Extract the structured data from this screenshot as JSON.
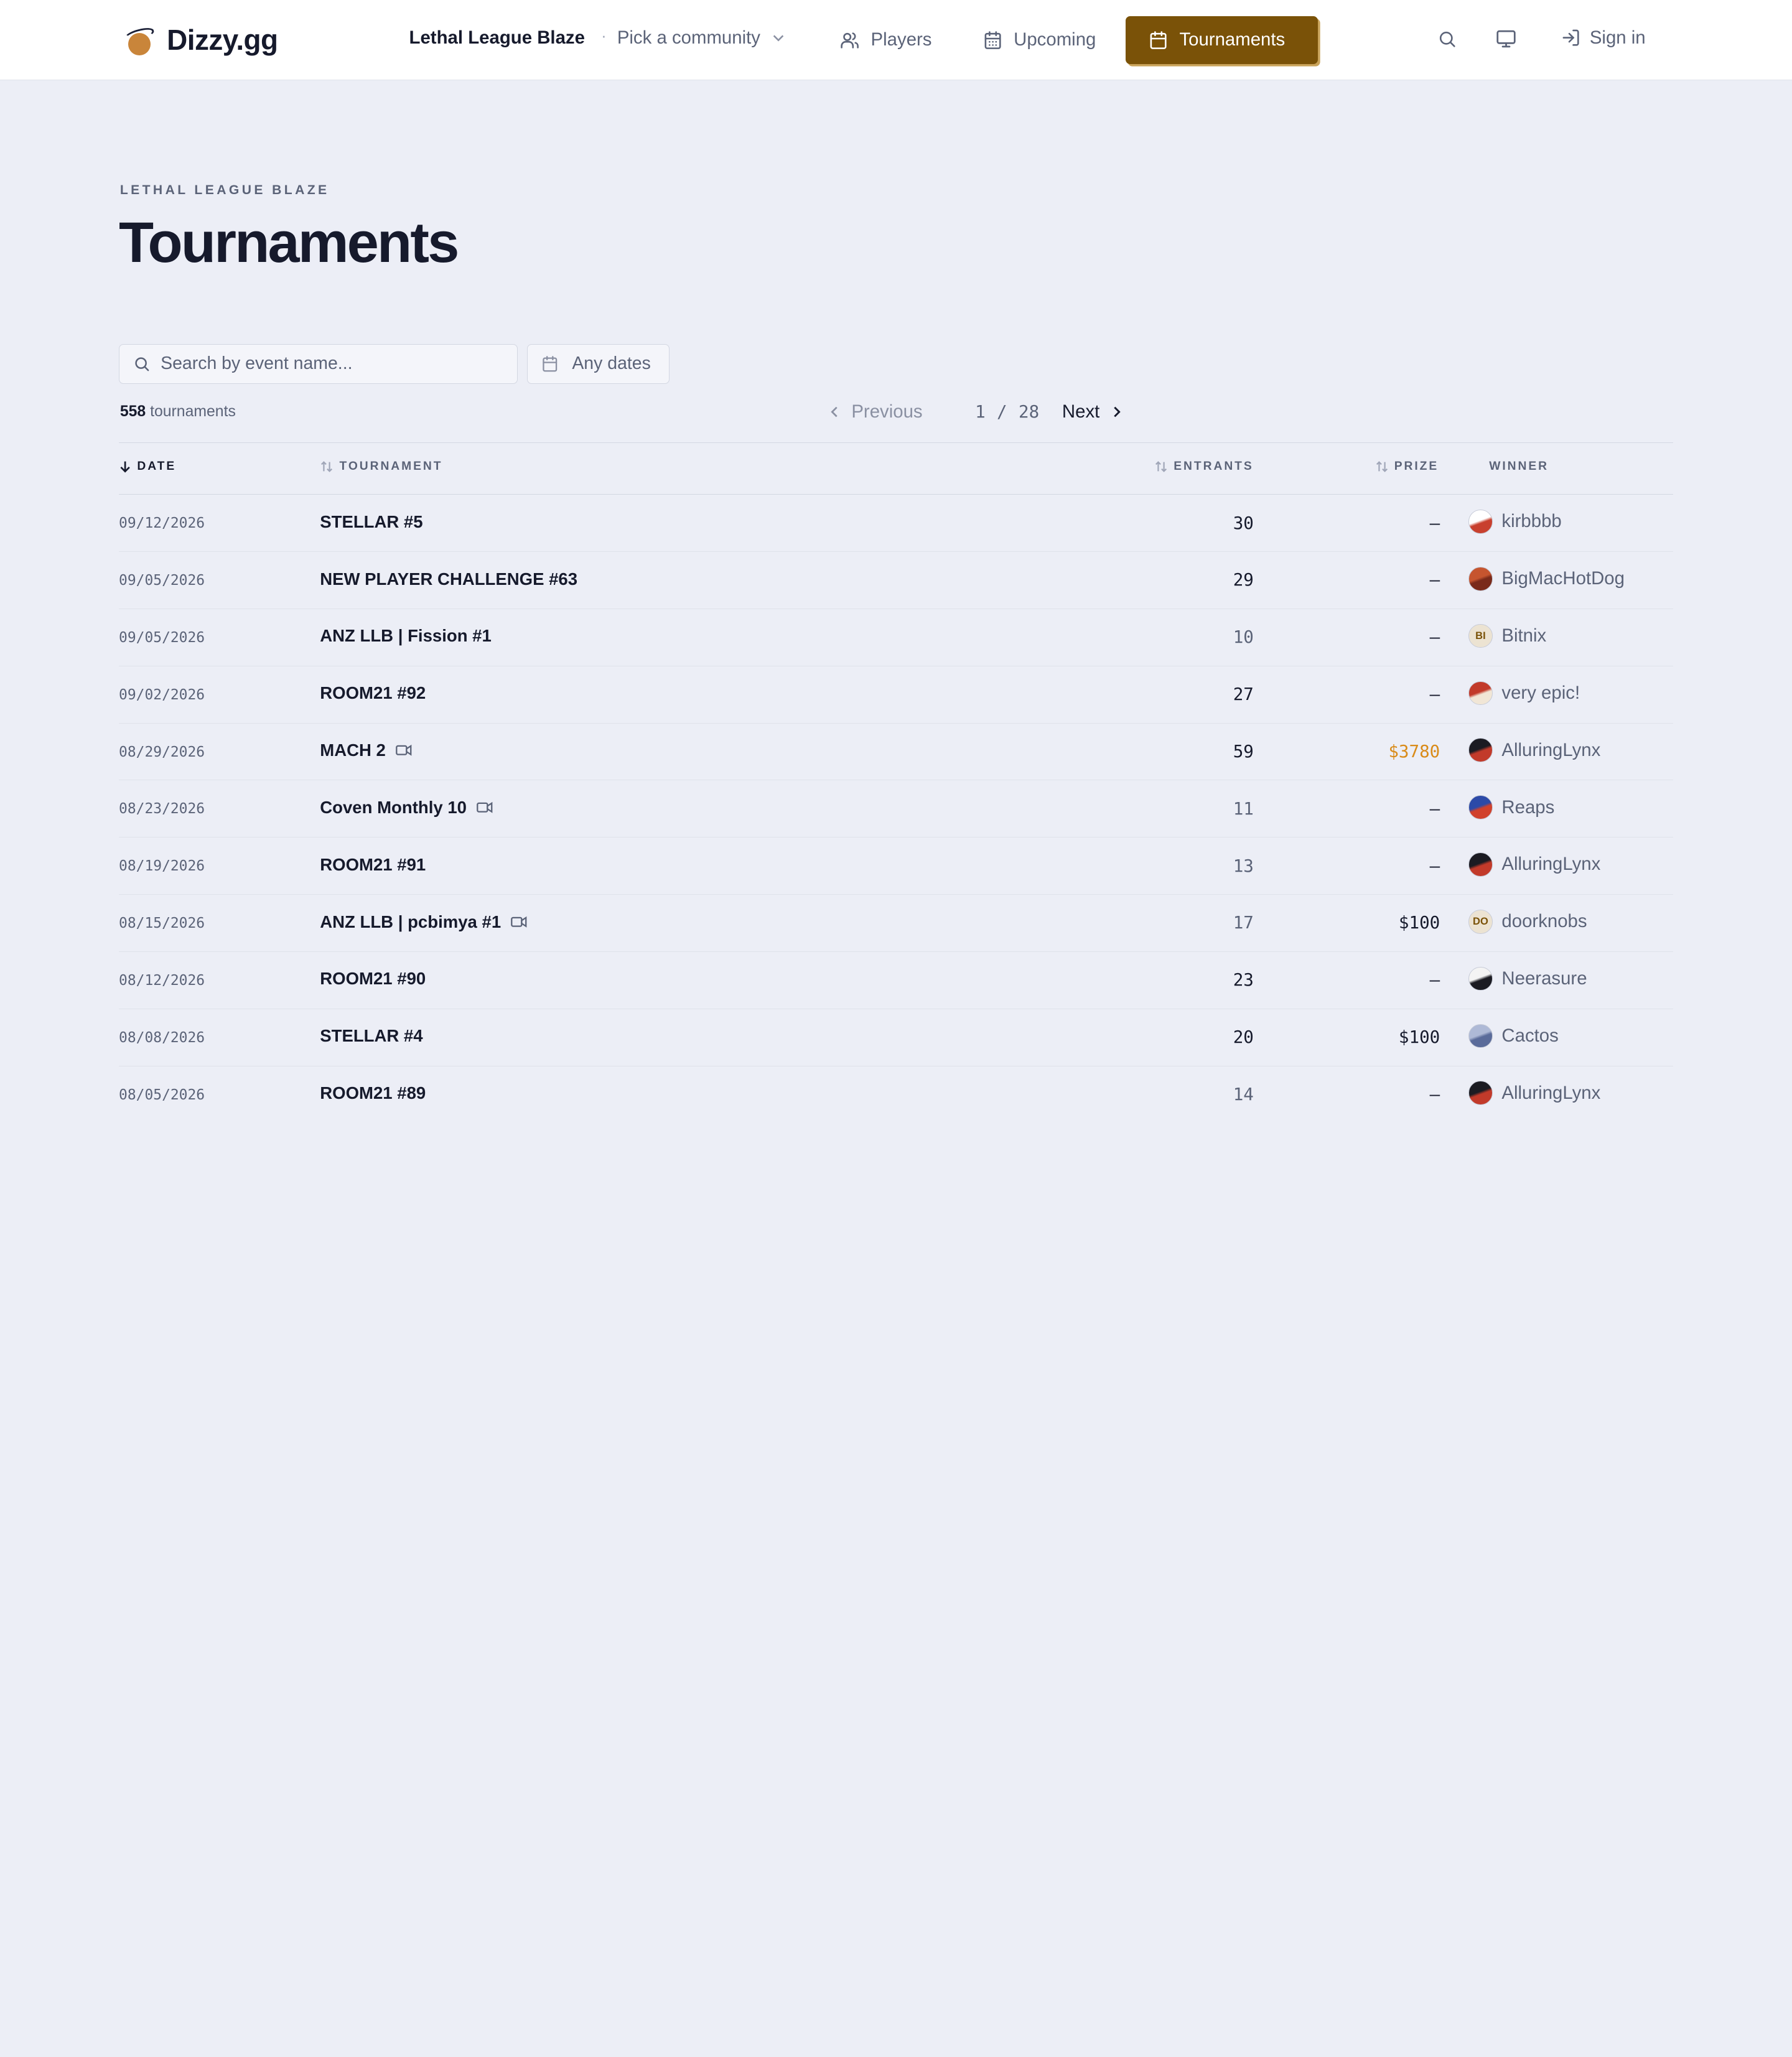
{
  "header": {
    "brand": "Dizzy.gg",
    "game": "Lethal League Blaze",
    "separator": "·",
    "community": "Pick a community",
    "nav": {
      "players": "Players",
      "upcoming": "Upcoming",
      "tournaments": "Tournaments"
    },
    "signin": "Sign in"
  },
  "page": {
    "eyebrow": "LETHAL LEAGUE BLAZE",
    "title": "Tournaments"
  },
  "filters": {
    "search_placeholder": "Search by event name...",
    "dates": "Any dates"
  },
  "summary": {
    "count": "558",
    "count_label": "tournaments"
  },
  "pager": {
    "previous": "Previous",
    "current": "1",
    "slash": "/",
    "total": "28",
    "next": "Next"
  },
  "table": {
    "columns": {
      "date": "DATE",
      "tournament": "TOURNAMENT",
      "entrants": "ENTRANTS",
      "prize": "PRIZE",
      "winner": "WINNER"
    },
    "rows": [
      {
        "date": "09/12/2026",
        "name": "STELLAR #5",
        "stream": false,
        "entrants": "30",
        "prize": "–",
        "winner": "kirbbbb",
        "avatar": {
          "kind": "image",
          "colors": [
            "#ffffff",
            "#c8402e"
          ]
        }
      },
      {
        "date": "09/05/2026",
        "name": "NEW PLAYER CHALLENGE #63",
        "stream": false,
        "entrants": "29",
        "prize": "–",
        "winner": "BigMacHotDog",
        "avatar": {
          "kind": "image",
          "colors": [
            "#c6552f",
            "#7a2a1a"
          ]
        }
      },
      {
        "date": "09/05/2026",
        "name": "ANZ LLB | Fission #1",
        "stream": false,
        "entrants": "10",
        "prize": "–",
        "winner": "Bitnix",
        "avatar": {
          "kind": "text",
          "text": "BI"
        }
      },
      {
        "date": "09/02/2026",
        "name": "ROOM21 #92",
        "stream": false,
        "entrants": "27",
        "prize": "–",
        "winner": "very epic!",
        "avatar": {
          "kind": "image",
          "colors": [
            "#c23a2a",
            "#f1e6d6"
          ]
        }
      },
      {
        "date": "08/29/2026",
        "name": "MACH 2",
        "stream": true,
        "entrants": "59",
        "prize": "$3780",
        "winner": "AlluringLynx",
        "avatar": {
          "kind": "image",
          "colors": [
            "#1b1b22",
            "#c23a2a"
          ]
        }
      },
      {
        "date": "08/23/2026",
        "name": "Coven Monthly 10",
        "stream": true,
        "entrants": "11",
        "prize": "–",
        "winner": "Reaps",
        "avatar": {
          "kind": "image",
          "colors": [
            "#2c4aa8",
            "#d1412c"
          ]
        }
      },
      {
        "date": "08/19/2026",
        "name": "ROOM21 #91",
        "stream": false,
        "entrants": "13",
        "prize": "–",
        "winner": "AlluringLynx",
        "avatar": {
          "kind": "image",
          "colors": [
            "#1b1b22",
            "#c23a2a"
          ]
        }
      },
      {
        "date": "08/15/2026",
        "name": "ANZ LLB | pcbimya #1",
        "stream": true,
        "entrants": "17",
        "prize": "$100",
        "winner": "doorknobs",
        "avatar": {
          "kind": "text",
          "text": "DO"
        }
      },
      {
        "date": "08/12/2026",
        "name": "ROOM21 #90",
        "stream": false,
        "entrants": "23",
        "prize": "–",
        "winner": "Neerasure",
        "avatar": {
          "kind": "image",
          "colors": [
            "#f4f4f4",
            "#1b1b22"
          ]
        }
      },
      {
        "date": "08/08/2026",
        "name": "STELLAR #4",
        "stream": false,
        "entrants": "20",
        "prize": "$100",
        "winner": "Cactos",
        "avatar": {
          "kind": "image",
          "colors": [
            "#aeb9d6",
            "#5a6b9a"
          ]
        }
      },
      {
        "date": "08/05/2026",
        "name": "ROOM21 #89",
        "stream": false,
        "entrants": "14",
        "prize": "–",
        "winner": "AlluringLynx",
        "avatar": {
          "kind": "image",
          "colors": [
            "#1b1b22",
            "#c23a2a"
          ]
        }
      }
    ]
  },
  "colors": {
    "accent": "#7a5208",
    "accent_shadow": "#c9a35a",
    "prize_highlight": "#d98b19",
    "background": "#eceef6",
    "header_bg": "#ffffff"
  },
  "icons": {
    "logo": "ball-logo-icon",
    "community_chevron": "chevron-down-icon",
    "players": "users-icon",
    "upcoming": "calendar-icon",
    "tournaments": "calendar-icon",
    "search": "search-icon",
    "theme": "monitor-icon",
    "signin": "log-in-icon",
    "stream": "video-icon"
  }
}
